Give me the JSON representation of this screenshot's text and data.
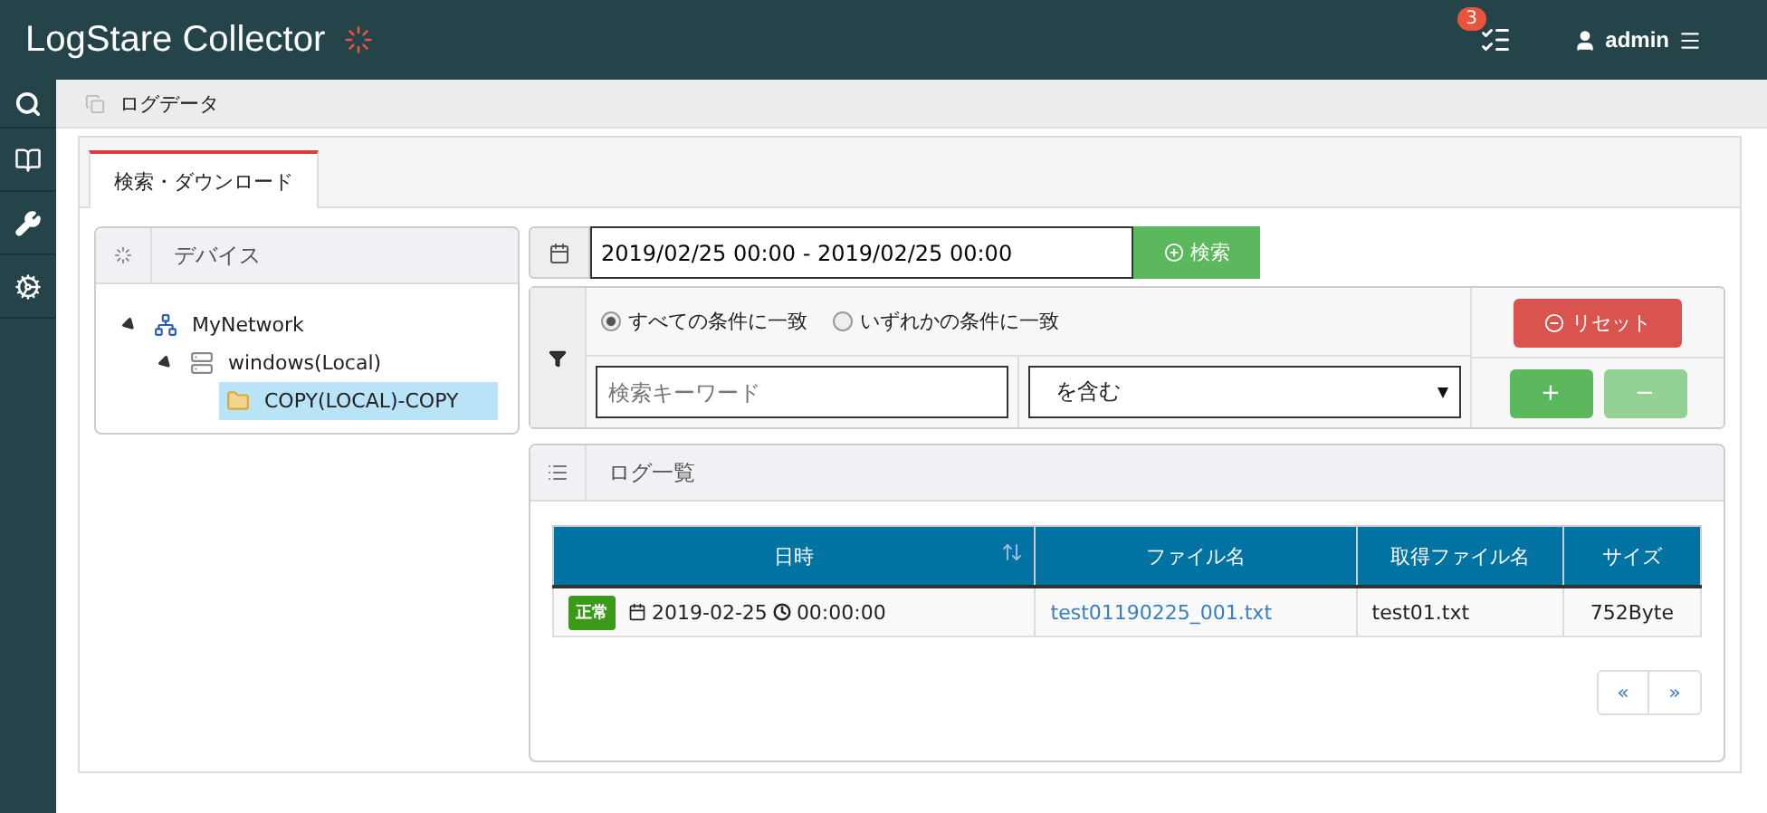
{
  "header": {
    "title": "LogStare Collector",
    "notification_count": "3",
    "user": "admin"
  },
  "breadcrumb": "ログデータ",
  "tabs": [
    {
      "label": "検索・ダウンロード",
      "selected": true
    }
  ],
  "devices": {
    "title": "デバイス",
    "tree": [
      {
        "label": "MyNetwork",
        "kind": "network",
        "expanded": true,
        "selected": false,
        "children": [
          {
            "label": "windows(Local)",
            "kind": "server",
            "expanded": true,
            "selected": false,
            "children": [
              {
                "label": "COPY(LOCAL)-COPY",
                "kind": "folder",
                "selected": true
              }
            ]
          }
        ]
      }
    ]
  },
  "search": {
    "date_range": "2019/02/25 00:00 - 2019/02/25 00:00",
    "search_button": "検索",
    "match_options": [
      {
        "label": "すべての条件に一致",
        "selected": true
      },
      {
        "label": "いずれかの条件に一致",
        "selected": false
      }
    ],
    "keyword_placeholder": "検索キーワード",
    "condition": "を含む",
    "reset_button": "リセット",
    "add_button": "+",
    "remove_button": "−",
    "remove_disabled": true
  },
  "log_list": {
    "title": "ログ一覧",
    "columns": [
      "日時",
      "ファイル名",
      "取得ファイル名",
      "サイズ"
    ],
    "rows": [
      {
        "status": "正常",
        "date": "2019-02-25",
        "time": "00:00:00",
        "file": "test01190225_001.txt",
        "source_file": "test01.txt",
        "size": "752Byte"
      }
    ],
    "pagination": [
      "«",
      "»"
    ]
  }
}
